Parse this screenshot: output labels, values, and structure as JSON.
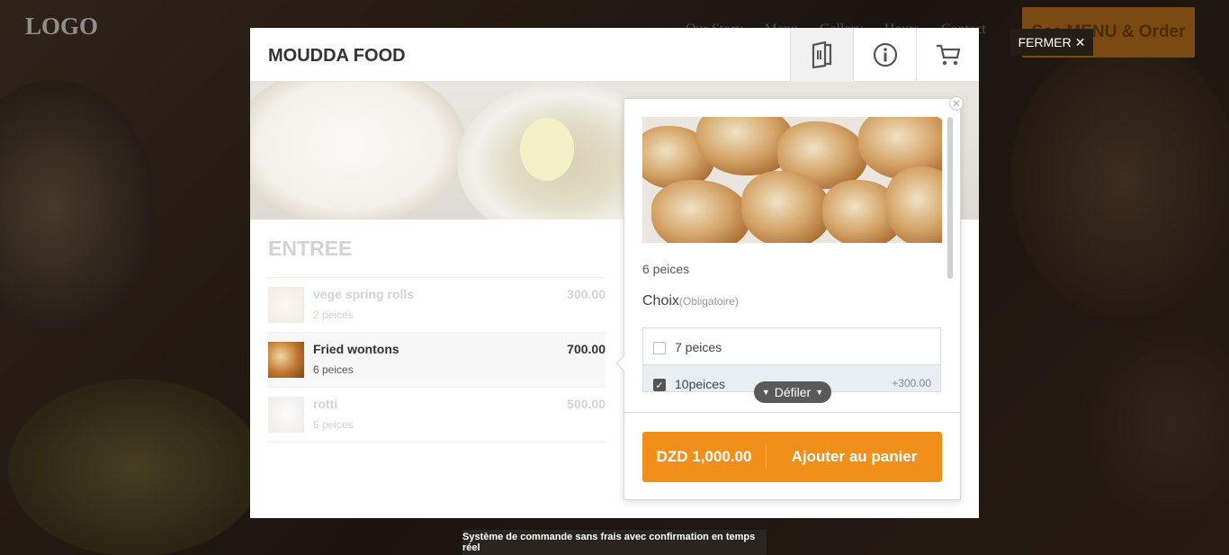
{
  "site": {
    "logo": "LOGO",
    "nav": [
      "Our Story",
      "Menu",
      "Gallery",
      "Hours",
      "Contact"
    ],
    "order_button": "See MENU & Order"
  },
  "overlay": {
    "close_label": "FERMER",
    "close_icon": "close-icon"
  },
  "modal": {
    "title": "MOUDDA FOOD",
    "header_icons": [
      "menu-book-icon",
      "info-icon",
      "cart-icon"
    ],
    "section": "ENTREE",
    "items": [
      {
        "name": "vege spring rolls",
        "desc": "2 peices",
        "price": "300.00",
        "state": "faded"
      },
      {
        "name": "Fried wontons",
        "desc": "6 peices",
        "price": "700.00",
        "state": "active"
      },
      {
        "name": "rotti",
        "desc": "6 peices",
        "price": "500.00",
        "state": "faded"
      }
    ]
  },
  "popup": {
    "description": "6 peices",
    "choice_label": "Choix",
    "choice_note": "(Obligatoire)",
    "options": [
      {
        "label": "7 peices",
        "price": "",
        "checked": false
      },
      {
        "label": "10peices",
        "price": "+300.00",
        "checked": true
      }
    ],
    "scroll_hint": "Défiler",
    "total": "DZD 1,000.00",
    "add_button": "Ajouter au panier"
  },
  "footer_toast": "Système de commande sans frais avec confirmation en temps réel",
  "colors": {
    "accent": "#f0901a",
    "dark": "#2a2520"
  }
}
